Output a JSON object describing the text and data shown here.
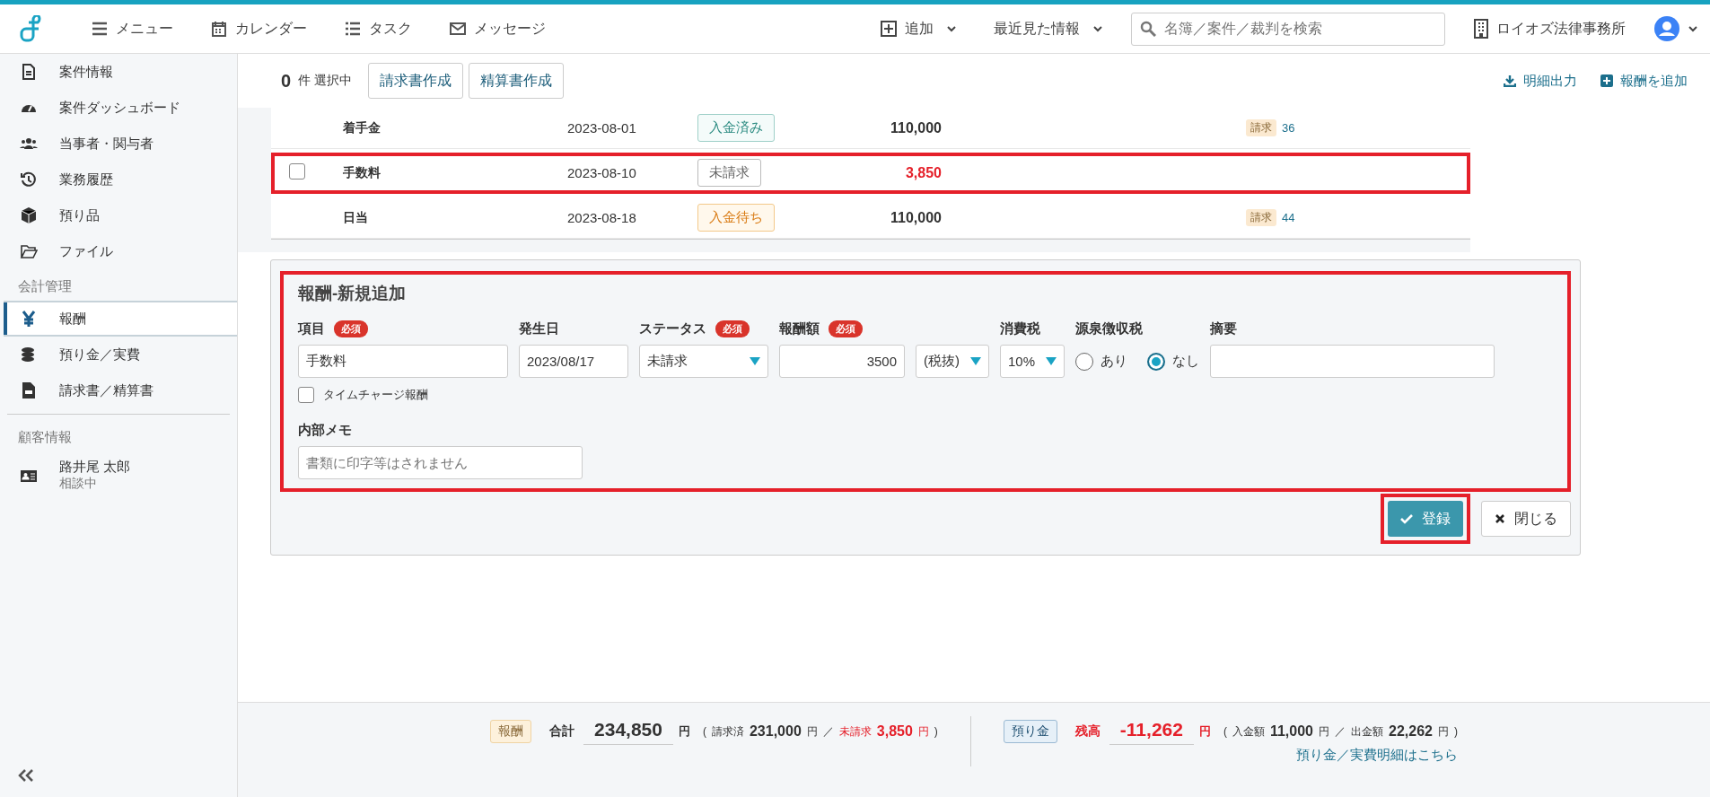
{
  "topbar": {
    "nav": [
      {
        "label": "メニュー",
        "kind": "menu"
      },
      {
        "label": "カレンダー",
        "kind": "calendar"
      },
      {
        "label": "タスク",
        "kind": "list"
      },
      {
        "label": "メッセージ",
        "kind": "mail"
      }
    ],
    "add": "追加",
    "recent": "最近見た情報",
    "search": {
      "placeholder": "名簿／案件／裁判を検索"
    },
    "office": "ロイオズ法律事務所"
  },
  "sidebar": {
    "items": [
      {
        "label": "案件情報",
        "kind": "doc",
        "selected": false
      },
      {
        "label": "案件ダッシュボード",
        "kind": "gauge",
        "selected": false
      },
      {
        "label": "当事者・関与者",
        "kind": "people",
        "selected": false
      },
      {
        "label": "業務履歴",
        "kind": "history",
        "selected": false
      },
      {
        "label": "預り品",
        "kind": "box",
        "selected": false
      },
      {
        "label": "ファイル",
        "kind": "folder",
        "selected": false
      }
    ],
    "accounting_header": "会計管理",
    "accounting_items": [
      {
        "label": "報酬",
        "kind": "yen",
        "selected": true
      },
      {
        "label": "預り金／実費",
        "kind": "coins",
        "selected": false
      },
      {
        "label": "請求書／精算書",
        "kind": "invoice",
        "selected": false
      }
    ],
    "client_header": "顧客情報",
    "client": {
      "name": "路井尾 太郎",
      "status": "相談中"
    }
  },
  "toolbar": {
    "count": "0",
    "count_label": "件 選択中",
    "buttons": [
      "請求書作成",
      "精算書作成"
    ],
    "export": "明細出力",
    "add_fee": "報酬を追加"
  },
  "table": {
    "rows": [
      {
        "kind": "billed",
        "item": "着手金",
        "date": "2023-08-01",
        "status": {
          "label": "入金済み",
          "kind": "paid"
        },
        "amount": {
          "value": "110,000",
          "kind": "normal"
        },
        "highlighted": false,
        "invoice_tag": "請求",
        "invoice_no": "36"
      },
      {
        "kind": "selectable",
        "checked": false,
        "item": "手数料",
        "date": "2023-08-10",
        "status": {
          "label": "未請求",
          "kind": "unbilled"
        },
        "amount": {
          "value": "3,850",
          "kind": "unbilled"
        },
        "highlighted": true
      },
      {
        "kind": "billed",
        "item": "日当",
        "date": "2023-08-18",
        "status": {
          "label": "入金待ち",
          "kind": "waiting"
        },
        "amount": {
          "value": "110,000",
          "kind": "normal"
        },
        "highlighted": false,
        "invoice_tag": "請求",
        "invoice_no": "44"
      }
    ]
  },
  "form": {
    "title": "報酬-新規追加",
    "highlighted": true,
    "item": {
      "label": "項目",
      "required": "必須",
      "value": "手数料"
    },
    "date": {
      "label": "発生日",
      "value": "2023/08/17"
    },
    "status": {
      "label": "ステータス",
      "required": "必須",
      "value": "未請求"
    },
    "amount": {
      "label": "報酬額",
      "required": "必須",
      "value": "3500",
      "tax_mode": "(税抜)"
    },
    "tax": {
      "label": "消費税",
      "value": "10%"
    },
    "withholding": {
      "label": "源泉徴収税",
      "options": [
        {
          "label": "あり",
          "selected": false
        },
        {
          "label": "なし",
          "selected": true
        }
      ]
    },
    "summary": {
      "label": "摘要"
    },
    "time_charge": {
      "label": "タイムチャージ報酬",
      "checked": false
    },
    "memo": {
      "label": "内部メモ",
      "placeholder": "書類に印字等はされません"
    },
    "submit": {
      "label": "登録",
      "highlighted": true
    },
    "close": "閉じる"
  },
  "footer": {
    "fee": {
      "tag": "報酬",
      "total_label": "合計",
      "total": "234,850",
      "unit": "円",
      "open": "(",
      "billed_label": "請求済",
      "billed": "231,000",
      "billed_unit": "円",
      "sep": "／",
      "unbilled_label": "未請求",
      "unbilled": "3,850",
      "unbilled_unit": "円",
      "close": ")"
    },
    "deposit": {
      "tag": "預り金",
      "balance_label": "残高",
      "balance": "-11,262",
      "unit": "円",
      "open": "(",
      "in_label": "入金額",
      "in": "11,000",
      "in_unit": "円",
      "sep": "／",
      "out_label": "出金額",
      "out": "22,262",
      "out_unit": "円",
      "close": ")",
      "link": "預り金／実費明細はこちら"
    }
  }
}
